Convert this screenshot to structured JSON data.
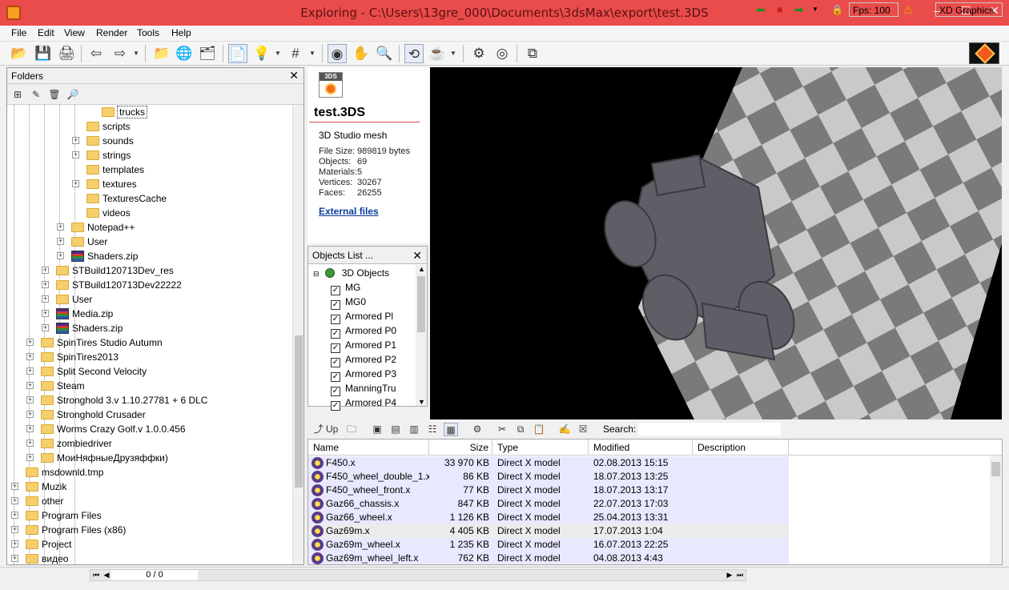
{
  "window": {
    "title": "Exploring - C:\\Users\\13gre_000\\Documents\\3dsMax\\export\\test.3DS",
    "controls": {
      "minimize": "–",
      "maximize": "☐",
      "close": "✕"
    }
  },
  "menu": [
    "File",
    "Edit",
    "View",
    "Render",
    "Tools",
    "Help"
  ],
  "toolbar_icons": [
    "open-folder-icon",
    "save-icon",
    "print-icon",
    "back-arrow-icon",
    "forward-arrow-icon",
    "folder-icon",
    "globe-icon",
    "network-folder-icon",
    "document-view-icon",
    "light-bulb-icon",
    "grid-icon",
    "orbit-icon",
    "pan-hand-icon",
    "zoom-icon",
    "rotate-icon",
    "teapot-icon",
    "settings-gear-icon",
    "camera-icon",
    "fullscreen-icon"
  ],
  "folders": {
    "title": "Folders",
    "close": "✕",
    "tree": [
      {
        "label": "trucks",
        "level": 6,
        "expander": false,
        "icon": "folder",
        "selected": true
      },
      {
        "label": "scripts",
        "level": 5,
        "expander": false,
        "icon": "folder"
      },
      {
        "label": "sounds",
        "level": 5,
        "expander": true,
        "icon": "folder"
      },
      {
        "label": "strings",
        "level": 5,
        "expander": true,
        "icon": "folder"
      },
      {
        "label": "templates",
        "level": 5,
        "expander": false,
        "icon": "folder"
      },
      {
        "label": "textures",
        "level": 5,
        "expander": true,
        "icon": "folder"
      },
      {
        "label": "TexturesCache",
        "level": 5,
        "expander": false,
        "icon": "folder"
      },
      {
        "label": "videos",
        "level": 5,
        "expander": false,
        "icon": "folder"
      },
      {
        "label": "Notepad++",
        "level": 4,
        "expander": true,
        "icon": "folder"
      },
      {
        "label": "User",
        "level": 4,
        "expander": true,
        "icon": "folder"
      },
      {
        "label": "Shaders.zip",
        "level": 4,
        "expander": true,
        "icon": "zip"
      },
      {
        "label": "STBuild120713Dev_res",
        "level": 3,
        "expander": true,
        "icon": "folder"
      },
      {
        "label": "STBuild120713Dev22222",
        "level": 3,
        "expander": true,
        "icon": "folder"
      },
      {
        "label": "User",
        "level": 3,
        "expander": true,
        "icon": "folder"
      },
      {
        "label": "Media.zip",
        "level": 3,
        "expander": true,
        "icon": "zip"
      },
      {
        "label": "Shaders.zip",
        "level": 3,
        "expander": true,
        "icon": "zip"
      },
      {
        "label": "SpinTires Studio Autumn",
        "level": 2,
        "expander": true,
        "icon": "folder"
      },
      {
        "label": "SpinTires2013",
        "level": 2,
        "expander": true,
        "icon": "folder"
      },
      {
        "label": "Split Second Velocity",
        "level": 2,
        "expander": true,
        "icon": "folder"
      },
      {
        "label": "Steam",
        "level": 2,
        "expander": true,
        "icon": "folder"
      },
      {
        "label": "Stronghold 3.v 1.10.27781 + 6 DLC",
        "level": 2,
        "expander": true,
        "icon": "folder"
      },
      {
        "label": "Stronghold Crusader",
        "level": 2,
        "expander": true,
        "icon": "folder"
      },
      {
        "label": "Worms Crazy Golf.v 1.0.0.456",
        "level": 2,
        "expander": true,
        "icon": "folder"
      },
      {
        "label": "zombiedriver",
        "level": 2,
        "expander": true,
        "icon": "folder"
      },
      {
        "label": "МоиНяфныеДрузяффки)",
        "level": 2,
        "expander": true,
        "icon": "folder"
      },
      {
        "label": "msdownld.tmp",
        "level": 1,
        "expander": false,
        "icon": "folder"
      },
      {
        "label": "Muzik",
        "level": 1,
        "expander": true,
        "icon": "folder"
      },
      {
        "label": "other",
        "level": 1,
        "expander": true,
        "icon": "folder"
      },
      {
        "label": "Program Files",
        "level": 1,
        "expander": true,
        "icon": "folder"
      },
      {
        "label": "Program Files (x86)",
        "level": 1,
        "expander": true,
        "icon": "folder"
      },
      {
        "label": "Project",
        "level": 1,
        "expander": true,
        "icon": "folder"
      },
      {
        "label": "видео",
        "level": 1,
        "expander": true,
        "icon": "folder"
      }
    ]
  },
  "info": {
    "icon_label": "3DS",
    "file_name": "test.3DS",
    "file_type": "3D Studio mesh",
    "stats": [
      {
        "label": "File Size:",
        "value": "989819 bytes"
      },
      {
        "label": "Objects:",
        "value": "69"
      },
      {
        "label": "Materials:",
        "value": "5"
      },
      {
        "label": "Vertices:",
        "value": "30267"
      },
      {
        "label": "Faces:",
        "value": "26255"
      }
    ],
    "external_files": "External files"
  },
  "objects_list": {
    "title": "Objects List ...",
    "close": "✕",
    "root": "3D Objects",
    "items": [
      "MG",
      "MG0",
      "Armored Pl",
      "Armored P0",
      "Armored P1",
      "Armored P2",
      "Armored P3",
      "ManningTru",
      "Armored P4"
    ]
  },
  "browser": {
    "up_label": "Up",
    "search_label": "Search:",
    "search_value": "",
    "columns": [
      "Name",
      "Size",
      "Type",
      "Modified",
      "Description"
    ],
    "files": [
      {
        "name": "F450.x",
        "size": "33 970 KB",
        "type": "Direct X model",
        "modified": "02.08.2013 15:15"
      },
      {
        "name": "F450_wheel_double_1.x",
        "size": "86 KB",
        "type": "Direct X model",
        "modified": "18.07.2013 13:25"
      },
      {
        "name": "F450_wheel_front.x",
        "size": "77 KB",
        "type": "Direct X model",
        "modified": "18.07.2013 13:17"
      },
      {
        "name": "Gaz66_chassis.x",
        "size": "847 KB",
        "type": "Direct X model",
        "modified": "22.07.2013 17:03"
      },
      {
        "name": "Gaz66_wheel.x",
        "size": "1 126 KB",
        "type": "Direct X model",
        "modified": "25.04.2013 13:31"
      },
      {
        "name": "Gaz69m.x",
        "size": "4 405 KB",
        "type": "Direct X model",
        "modified": "17.07.2013 1:04"
      },
      {
        "name": "Gaz69m_wheel.x",
        "size": "1 235 KB",
        "type": "Direct X model",
        "modified": "16.07.2013 22:25"
      },
      {
        "name": "Gaz69m_wheel_left.x",
        "size": "762 KB",
        "type": "Direct X model",
        "modified": "04.08.2013 4:43"
      }
    ]
  },
  "status": {
    "page": "0 / 0",
    "fps": "Fps: 100",
    "renderer": "XD Graphics"
  },
  "colors": {
    "titlebar": "#ea4b4b",
    "row_highlight": "#e8e8ff",
    "link": "#0b3b9c"
  }
}
